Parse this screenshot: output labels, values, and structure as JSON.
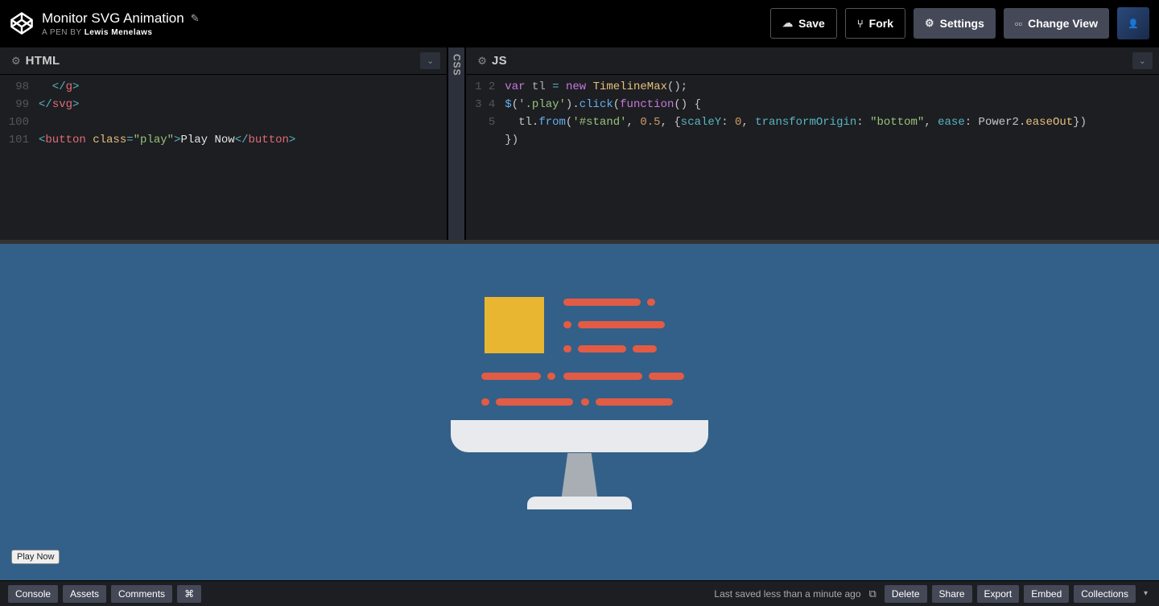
{
  "header": {
    "title": "Monitor SVG Animation",
    "byline_prefix": "A PEN BY ",
    "author": "Lewis Menelaws",
    "save": "Save",
    "fork": "Fork",
    "settings": "Settings",
    "changeView": "Change View"
  },
  "editors": {
    "html": {
      "label": "HTML",
      "gutter": [
        "98",
        "99",
        "100",
        "101"
      ],
      "lines": [
        [
          {
            "cls": "t-op",
            "txt": "  </"
          },
          {
            "cls": "t-tag",
            "txt": "g"
          },
          {
            "cls": "t-op",
            "txt": ">"
          }
        ],
        [
          {
            "cls": "t-op",
            "txt": "</"
          },
          {
            "cls": "t-tag",
            "txt": "svg"
          },
          {
            "cls": "t-op",
            "txt": ">"
          }
        ],
        [
          {
            "cls": "",
            "txt": ""
          }
        ],
        [
          {
            "cls": "t-op",
            "txt": "<"
          },
          {
            "cls": "t-tag",
            "txt": "button "
          },
          {
            "cls": "t-yellow",
            "txt": "class"
          },
          {
            "cls": "t-op",
            "txt": "="
          },
          {
            "cls": "t-str",
            "txt": "\"play\""
          },
          {
            "cls": "t-op",
            "txt": ">"
          },
          {
            "cls": "t-plain",
            "txt": "Play Now"
          },
          {
            "cls": "t-op",
            "txt": "</"
          },
          {
            "cls": "t-tag",
            "txt": "button"
          },
          {
            "cls": "t-op",
            "txt": ">"
          }
        ]
      ]
    },
    "css": {
      "label": "CSS"
    },
    "js": {
      "label": "JS",
      "gutter": [
        "1",
        "2",
        "3",
        "4",
        "5"
      ],
      "lines": [
        [
          {
            "cls": "t-kw",
            "txt": "var"
          },
          {
            "cls": "",
            "txt": " "
          },
          {
            "cls": "t-var",
            "txt": "tl"
          },
          {
            "cls": "",
            "txt": " "
          },
          {
            "cls": "t-op",
            "txt": "="
          },
          {
            "cls": "",
            "txt": " "
          },
          {
            "cls": "t-kw",
            "txt": "new"
          },
          {
            "cls": "",
            "txt": " "
          },
          {
            "cls": "t-yellow",
            "txt": "TimelineMax"
          },
          {
            "cls": "",
            "txt": "();"
          }
        ],
        [
          {
            "cls": "t-blue",
            "txt": "$"
          },
          {
            "cls": "",
            "txt": "("
          },
          {
            "cls": "t-str",
            "txt": "'.play'"
          },
          {
            "cls": "",
            "txt": ")."
          },
          {
            "cls": "t-blue",
            "txt": "click"
          },
          {
            "cls": "",
            "txt": "("
          },
          {
            "cls": "t-kw",
            "txt": "function"
          },
          {
            "cls": "",
            "txt": "() {"
          }
        ],
        [
          {
            "cls": "",
            "txt": "  tl."
          },
          {
            "cls": "t-blue",
            "txt": "from"
          },
          {
            "cls": "",
            "txt": "("
          },
          {
            "cls": "t-str",
            "txt": "'#stand'"
          },
          {
            "cls": "",
            "txt": ", "
          },
          {
            "cls": "t-num",
            "txt": "0.5"
          },
          {
            "cls": "",
            "txt": ", {"
          },
          {
            "cls": "t-cyan",
            "txt": "scaleY"
          },
          {
            "cls": "",
            "txt": ": "
          },
          {
            "cls": "t-num",
            "txt": "0"
          },
          {
            "cls": "",
            "txt": ", "
          },
          {
            "cls": "t-cyan",
            "txt": "transformOrigin"
          },
          {
            "cls": "",
            "txt": ": "
          },
          {
            "cls": "t-str",
            "txt": "\"bottom\""
          },
          {
            "cls": "",
            "txt": ", "
          },
          {
            "cls": "t-cyan",
            "txt": "ease"
          },
          {
            "cls": "",
            "txt": ": Power2."
          },
          {
            "cls": "t-yellow",
            "txt": "easeOut"
          },
          {
            "cls": "",
            "txt": "})"
          }
        ],
        [
          {
            "cls": "",
            "txt": "})"
          }
        ],
        [
          {
            "cls": "",
            "txt": ""
          }
        ]
      ]
    }
  },
  "preview": {
    "playButton": "Play Now"
  },
  "footer": {
    "console": "Console",
    "assets": "Assets",
    "comments": "Comments",
    "shortcut": "⌘",
    "status": "Last saved less than a minute ago",
    "delete": "Delete",
    "share": "Share",
    "export": "Export",
    "embed": "Embed",
    "collections": "Collections"
  }
}
